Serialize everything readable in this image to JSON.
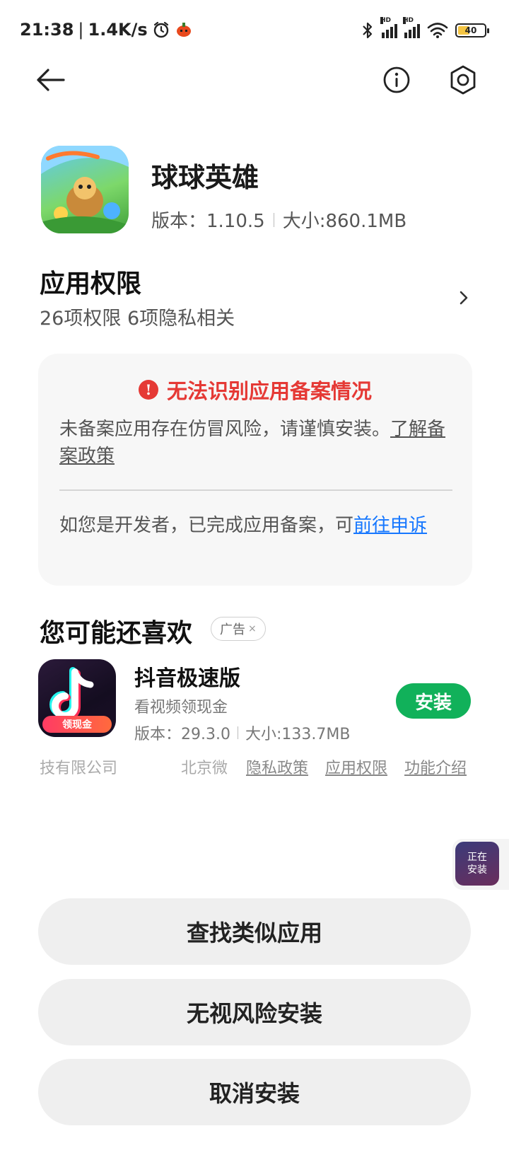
{
  "status_bar": {
    "time": "21:38",
    "speed": "1.4K/s",
    "battery": "40"
  },
  "app": {
    "name": "球球英雄",
    "version_text": "版本：1.10.5",
    "size_text": "大小:860.1MB"
  },
  "permissions": {
    "title": "应用权限",
    "subtitle": "26项权限 6项隐私相关"
  },
  "warning": {
    "title": "无法识别应用备案情况",
    "text": "未备案应用存在仿冒风险，请谨慎安装。",
    "link_text": "了解备案政策",
    "dev_text": "如您是开发者，已完成应用备案，可",
    "dev_link": "前往申诉"
  },
  "recommend": {
    "title": "您可能还喜欢",
    "ad_label": "广告",
    "ad_close": "×",
    "item": {
      "name": "抖音极速版",
      "desc": "看视频领现金",
      "version_text": "版本：29.3.0",
      "size_text": "大小:133.7MB",
      "install_label": "安装",
      "icon_tag": "领现金"
    },
    "company_a": "技有限公司",
    "company_b": "北京微",
    "links": [
      "隐私政策",
      "应用权限",
      "功能介绍"
    ]
  },
  "floating": {
    "line1": "正在",
    "line2": "安装"
  },
  "buttons": {
    "find_similar": "查找类似应用",
    "force_install": "无视风险安装",
    "cancel_install": "取消安装"
  }
}
